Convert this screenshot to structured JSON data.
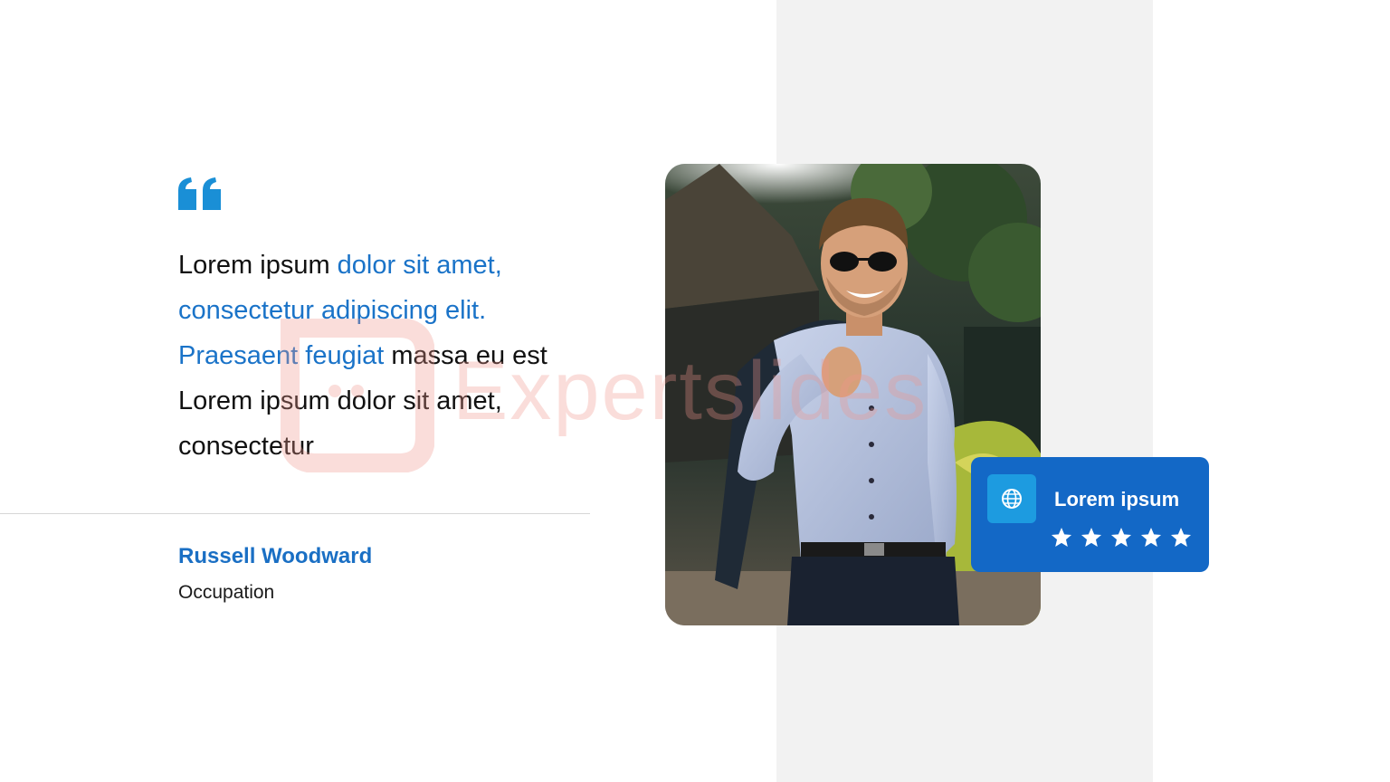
{
  "quote": {
    "icon": "quote-icon",
    "segments": [
      {
        "text": "Lorem ipsum ",
        "highlight": false
      },
      {
        "text": "dolor sit amet, consectetur adipiscing elit. Praesaent feugiat",
        "highlight": true
      },
      {
        "text": " massa eu est Lorem ipsum dolor sit amet, consectetur",
        "highlight": false
      }
    ]
  },
  "author": {
    "name": "Russell Woodward",
    "role": "Occupation"
  },
  "rating_card": {
    "icon": "globe-icon",
    "label": "Lorem ipsum",
    "stars": 5,
    "star_icon": "star-icon"
  },
  "watermark": {
    "text": "Expertslides"
  },
  "colors": {
    "accent": "#1a73c8",
    "quote_icon": "#1a8fd6",
    "card_bg": "#1368c6",
    "card_icon_bg": "#1d9be0",
    "panel": "#f2f2f2"
  }
}
